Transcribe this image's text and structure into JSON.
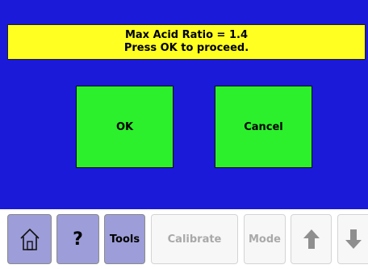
{
  "message": {
    "line1": "Max Acid Ratio = 1.4",
    "line2": "Press OK to proceed."
  },
  "dialog": {
    "ok_label": "OK",
    "cancel_label": "Cancel"
  },
  "toolbar": {
    "home_icon": "home-icon",
    "help_label": "?",
    "tools_label": "Tools",
    "calibrate_label": "Calibrate",
    "mode_label": "Mode",
    "up_icon": "arrow-up-icon",
    "down_icon": "arrow-down-icon"
  },
  "colors": {
    "background": "#1a1ad8",
    "message_bg": "#ffff22",
    "button_green": "#2cf02c",
    "toolbar_active": "#9d9dd9",
    "toolbar_disabled_text": "#a9a9a9"
  }
}
